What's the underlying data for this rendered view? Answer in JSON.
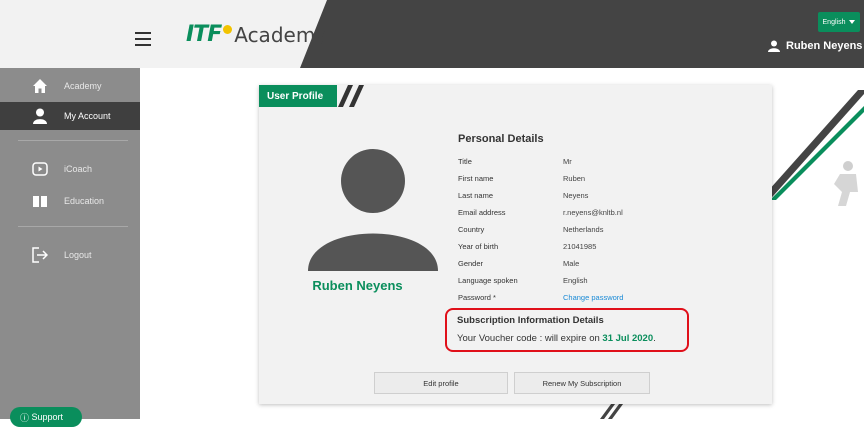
{
  "header": {
    "logo_itf": "ITF",
    "logo_academy": "Academy",
    "language": "English",
    "user_name": "Ruben Neyens"
  },
  "sidebar": {
    "items": [
      {
        "label": "Academy",
        "icon": "home-icon"
      },
      {
        "label": "My Account",
        "icon": "user-icon",
        "active": true
      },
      {
        "label": "iCoach",
        "icon": "play-icon"
      },
      {
        "label": "Education",
        "icon": "book-icon"
      },
      {
        "label": "Logout",
        "icon": "logout-icon"
      }
    ],
    "support_label": "Support"
  },
  "profile": {
    "tab_title": "User Profile",
    "display_name": "Ruben Neyens",
    "section_title": "Personal Details",
    "fields": [
      {
        "key": "Title",
        "value": "Mr"
      },
      {
        "key": "First name",
        "value": "Ruben"
      },
      {
        "key": "Last name",
        "value": "Neyens"
      },
      {
        "key": "Email address",
        "value": "r.neyens@knltb.nl"
      },
      {
        "key": "Country",
        "value": "Netherlands"
      },
      {
        "key": "Year of birth",
        "value": "21041985"
      },
      {
        "key": "Gender",
        "value": "Male"
      },
      {
        "key": "Language spoken",
        "value": "English"
      },
      {
        "key": "Password *",
        "value": "Change password"
      }
    ],
    "subscription": {
      "title": "Subscription Information Details",
      "text_prefix": "Your Voucher code : will expire on ",
      "expiry_date": "31 Jul 2020",
      "text_suffix": "."
    },
    "buttons": {
      "edit": "Edit profile",
      "renew": "Renew My Subscription"
    }
  },
  "colors": {
    "brand_green": "#0a8e5c",
    "sidebar_bg": "#8c8c8c",
    "highlight_red": "#e0101a",
    "link_blue": "#1a8ad6"
  }
}
